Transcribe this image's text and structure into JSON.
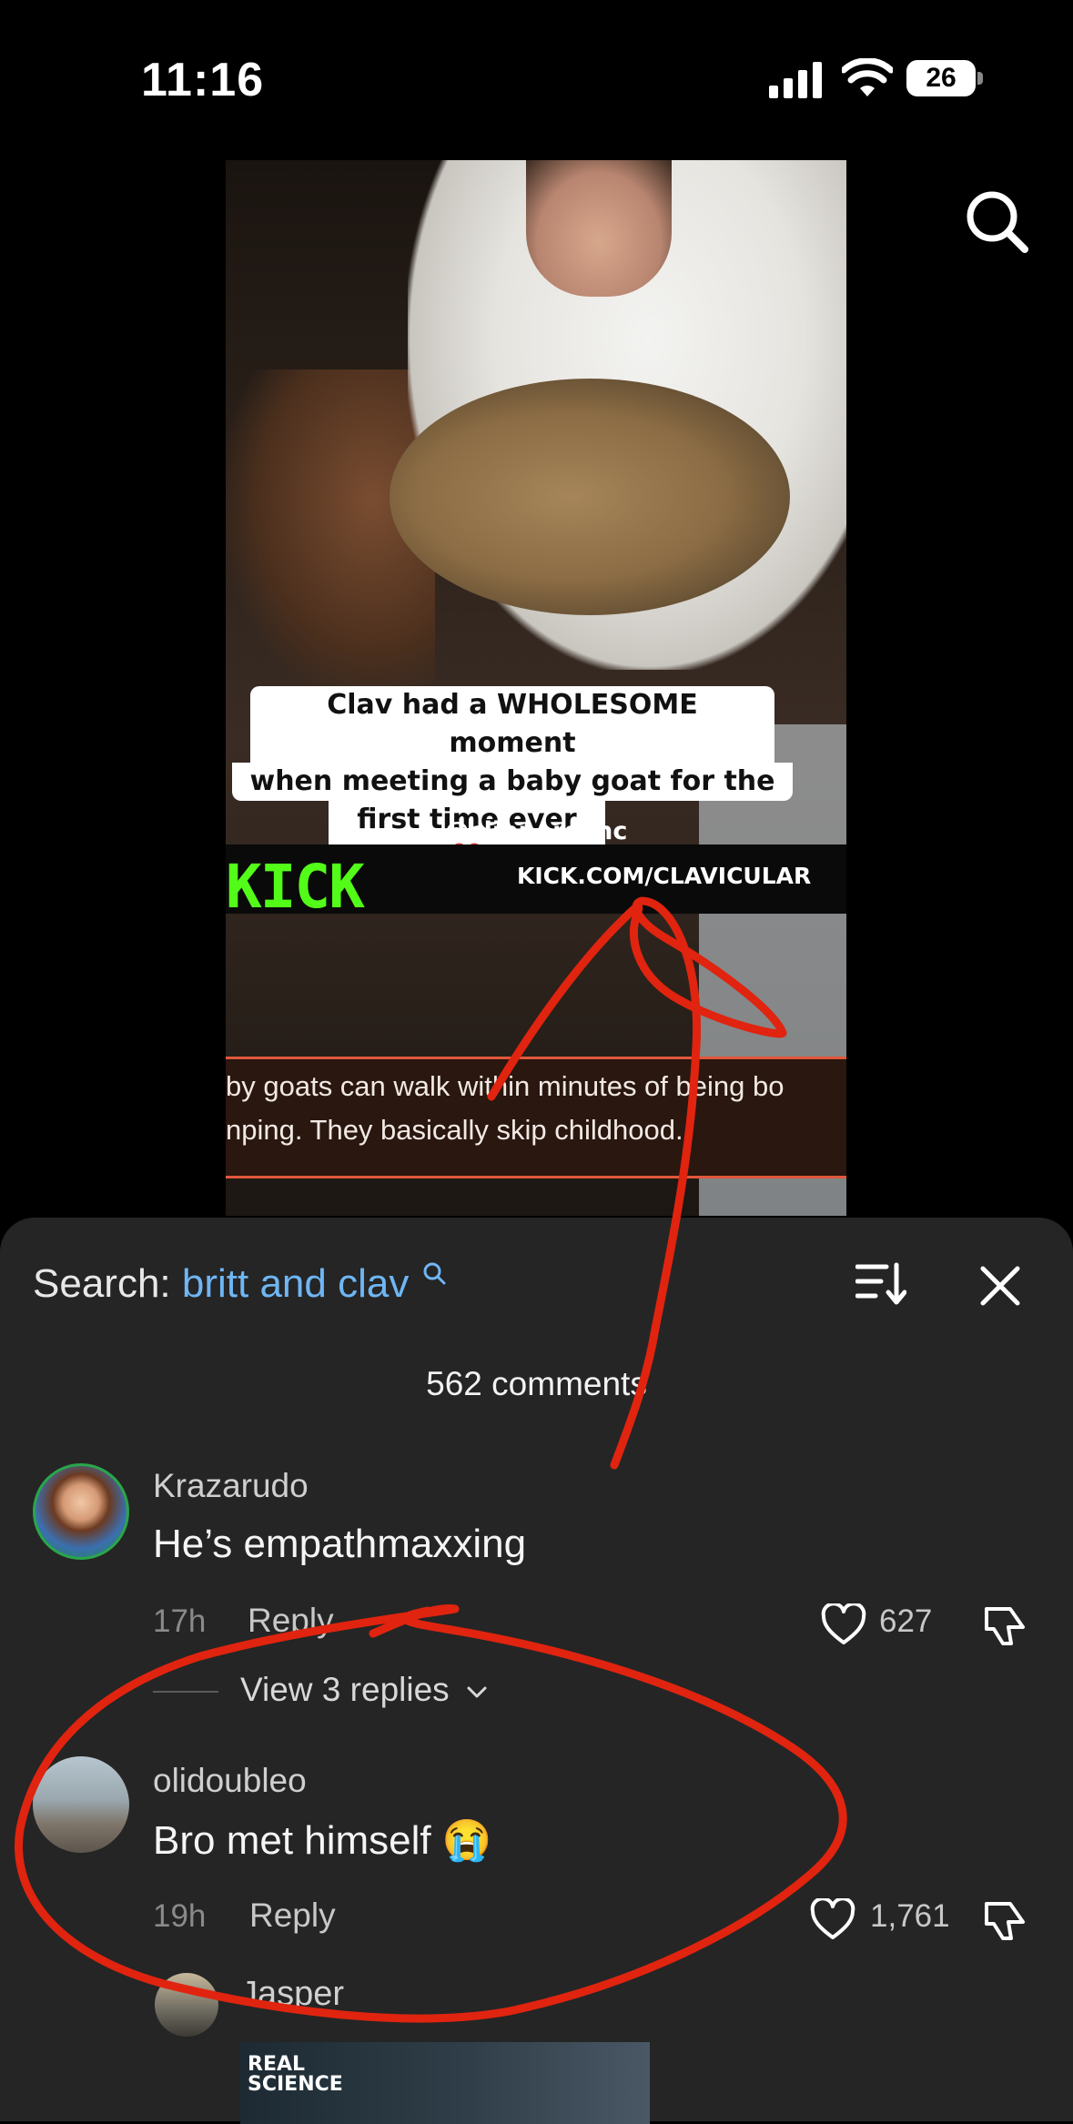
{
  "status_bar": {
    "time": "11:16",
    "battery": "26"
  },
  "video": {
    "caption_lines": [
      "Clav had a WHOLESOME moment",
      "when meeting a baby goat for the",
      "first time ever ❤️"
    ],
    "handle": "@clippersync",
    "kick_logo": "KICK",
    "kick_url": "KICK.COM/CLAVICULAR",
    "fact_lines": [
      "by goats can walk within minutes of being bo",
      "nping. They basically skip childhood."
    ]
  },
  "sheet": {
    "search_label": "Search:",
    "search_query": "britt and clav",
    "comment_count": "562 comments",
    "comments": [
      {
        "username": "Krazarudo",
        "text": "He’s empathmaxxing",
        "time": "17h",
        "reply": "Reply",
        "likes": "627",
        "view_replies": "View 3 replies"
      },
      {
        "username": "olidoubleo",
        "text": "Bro met himself 😭",
        "time": "19h",
        "reply": "Reply",
        "likes": "1,761"
      }
    ],
    "reply_preview": {
      "username": "Jasper",
      "image_text": [
        "REAL",
        "SCIENCE"
      ]
    }
  },
  "colors": {
    "accent_link": "#6fb6f4",
    "kick_green": "#53fc18",
    "annotation_red": "#e0240f"
  }
}
